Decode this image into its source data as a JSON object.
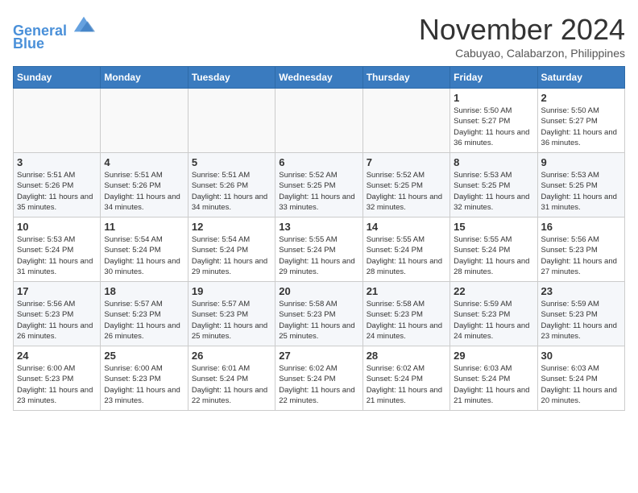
{
  "header": {
    "logo_line1": "General",
    "logo_line2": "Blue",
    "month_title": "November 2024",
    "location": "Cabuyao, Calabarzon, Philippines"
  },
  "weekdays": [
    "Sunday",
    "Monday",
    "Tuesday",
    "Wednesday",
    "Thursday",
    "Friday",
    "Saturday"
  ],
  "weeks": [
    [
      {
        "day": "",
        "info": ""
      },
      {
        "day": "",
        "info": ""
      },
      {
        "day": "",
        "info": ""
      },
      {
        "day": "",
        "info": ""
      },
      {
        "day": "",
        "info": ""
      },
      {
        "day": "1",
        "info": "Sunrise: 5:50 AM\nSunset: 5:27 PM\nDaylight: 11 hours and 36 minutes."
      },
      {
        "day": "2",
        "info": "Sunrise: 5:50 AM\nSunset: 5:27 PM\nDaylight: 11 hours and 36 minutes."
      }
    ],
    [
      {
        "day": "3",
        "info": "Sunrise: 5:51 AM\nSunset: 5:26 PM\nDaylight: 11 hours and 35 minutes."
      },
      {
        "day": "4",
        "info": "Sunrise: 5:51 AM\nSunset: 5:26 PM\nDaylight: 11 hours and 34 minutes."
      },
      {
        "day": "5",
        "info": "Sunrise: 5:51 AM\nSunset: 5:26 PM\nDaylight: 11 hours and 34 minutes."
      },
      {
        "day": "6",
        "info": "Sunrise: 5:52 AM\nSunset: 5:25 PM\nDaylight: 11 hours and 33 minutes."
      },
      {
        "day": "7",
        "info": "Sunrise: 5:52 AM\nSunset: 5:25 PM\nDaylight: 11 hours and 32 minutes."
      },
      {
        "day": "8",
        "info": "Sunrise: 5:53 AM\nSunset: 5:25 PM\nDaylight: 11 hours and 32 minutes."
      },
      {
        "day": "9",
        "info": "Sunrise: 5:53 AM\nSunset: 5:25 PM\nDaylight: 11 hours and 31 minutes."
      }
    ],
    [
      {
        "day": "10",
        "info": "Sunrise: 5:53 AM\nSunset: 5:24 PM\nDaylight: 11 hours and 31 minutes."
      },
      {
        "day": "11",
        "info": "Sunrise: 5:54 AM\nSunset: 5:24 PM\nDaylight: 11 hours and 30 minutes."
      },
      {
        "day": "12",
        "info": "Sunrise: 5:54 AM\nSunset: 5:24 PM\nDaylight: 11 hours and 29 minutes."
      },
      {
        "day": "13",
        "info": "Sunrise: 5:55 AM\nSunset: 5:24 PM\nDaylight: 11 hours and 29 minutes."
      },
      {
        "day": "14",
        "info": "Sunrise: 5:55 AM\nSunset: 5:24 PM\nDaylight: 11 hours and 28 minutes."
      },
      {
        "day": "15",
        "info": "Sunrise: 5:55 AM\nSunset: 5:24 PM\nDaylight: 11 hours and 28 minutes."
      },
      {
        "day": "16",
        "info": "Sunrise: 5:56 AM\nSunset: 5:23 PM\nDaylight: 11 hours and 27 minutes."
      }
    ],
    [
      {
        "day": "17",
        "info": "Sunrise: 5:56 AM\nSunset: 5:23 PM\nDaylight: 11 hours and 26 minutes."
      },
      {
        "day": "18",
        "info": "Sunrise: 5:57 AM\nSunset: 5:23 PM\nDaylight: 11 hours and 26 minutes."
      },
      {
        "day": "19",
        "info": "Sunrise: 5:57 AM\nSunset: 5:23 PM\nDaylight: 11 hours and 25 minutes."
      },
      {
        "day": "20",
        "info": "Sunrise: 5:58 AM\nSunset: 5:23 PM\nDaylight: 11 hours and 25 minutes."
      },
      {
        "day": "21",
        "info": "Sunrise: 5:58 AM\nSunset: 5:23 PM\nDaylight: 11 hours and 24 minutes."
      },
      {
        "day": "22",
        "info": "Sunrise: 5:59 AM\nSunset: 5:23 PM\nDaylight: 11 hours and 24 minutes."
      },
      {
        "day": "23",
        "info": "Sunrise: 5:59 AM\nSunset: 5:23 PM\nDaylight: 11 hours and 23 minutes."
      }
    ],
    [
      {
        "day": "24",
        "info": "Sunrise: 6:00 AM\nSunset: 5:23 PM\nDaylight: 11 hours and 23 minutes."
      },
      {
        "day": "25",
        "info": "Sunrise: 6:00 AM\nSunset: 5:23 PM\nDaylight: 11 hours and 23 minutes."
      },
      {
        "day": "26",
        "info": "Sunrise: 6:01 AM\nSunset: 5:24 PM\nDaylight: 11 hours and 22 minutes."
      },
      {
        "day": "27",
        "info": "Sunrise: 6:02 AM\nSunset: 5:24 PM\nDaylight: 11 hours and 22 minutes."
      },
      {
        "day": "28",
        "info": "Sunrise: 6:02 AM\nSunset: 5:24 PM\nDaylight: 11 hours and 21 minutes."
      },
      {
        "day": "29",
        "info": "Sunrise: 6:03 AM\nSunset: 5:24 PM\nDaylight: 11 hours and 21 minutes."
      },
      {
        "day": "30",
        "info": "Sunrise: 6:03 AM\nSunset: 5:24 PM\nDaylight: 11 hours and 20 minutes."
      }
    ]
  ]
}
